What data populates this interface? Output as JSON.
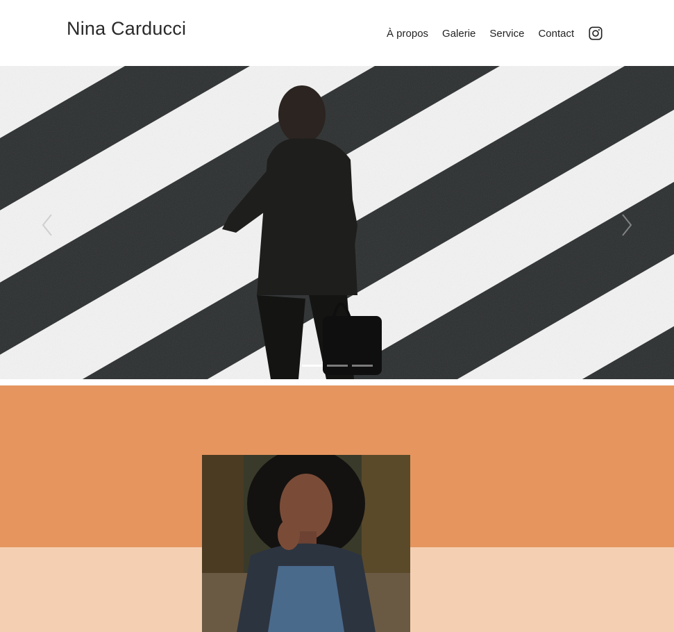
{
  "header": {
    "brand": "Nina Carducci",
    "nav": [
      "À propos",
      "Galerie",
      "Service",
      "Contact"
    ],
    "social_icon": "instagram-icon"
  },
  "carousel": {
    "slides_count": 3,
    "active_index": 0,
    "prev_icon": "chevron-left-icon",
    "next_icon": "chevron-right-icon"
  },
  "about": {
    "top_color": "#e6955f",
    "bottom_color": "#f5cfb2"
  },
  "colors": {
    "background": "#ffffff",
    "text": "#1f1f1f"
  }
}
